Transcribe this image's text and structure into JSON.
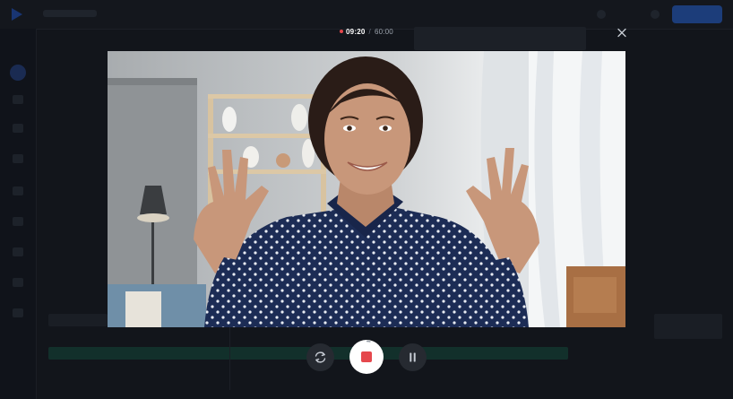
{
  "recorder": {
    "timer": {
      "current": "09:20",
      "separator": "/",
      "limit": "60:00"
    },
    "controls": {
      "restart_icon": "restart-icon",
      "record_icon": "stop-recording-icon",
      "pause_icon": "pause-icon",
      "close_icon": "close-icon"
    },
    "accent_color": "#e5484d"
  }
}
